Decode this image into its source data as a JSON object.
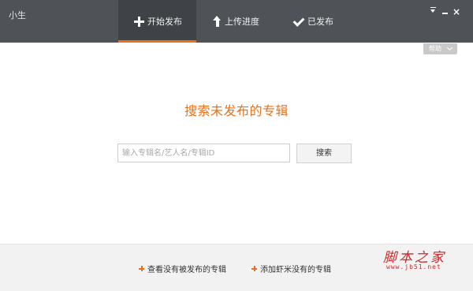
{
  "app": {
    "title": "小生"
  },
  "tabs": [
    {
      "label": "开始发布",
      "icon": "plus-icon",
      "active": true
    },
    {
      "label": "上传进度",
      "icon": "upload-arrow-icon",
      "active": false
    },
    {
      "label": "已发布",
      "icon": "check-icon",
      "active": false
    }
  ],
  "window_controls": {
    "close_glyph": "×"
  },
  "help": {
    "label": "帮助"
  },
  "main": {
    "title": "搜索未发布的专辑",
    "search_placeholder": "输入专辑名/艺人名/专辑ID",
    "search_value": "",
    "search_button": "搜索"
  },
  "footer": {
    "link_unpublished": "查看没有被发布的专辑",
    "link_missing": "添加虾米没有的专辑"
  },
  "watermark": {
    "text": "脚本之家",
    "url": "www.jb51.net"
  },
  "colors": {
    "header_bg": "#4f5257",
    "active_tab_bg": "#3f4247",
    "accent": "#e8711a",
    "footer_bg": "#f2f2f2",
    "watermark": "#cc2a2a"
  }
}
